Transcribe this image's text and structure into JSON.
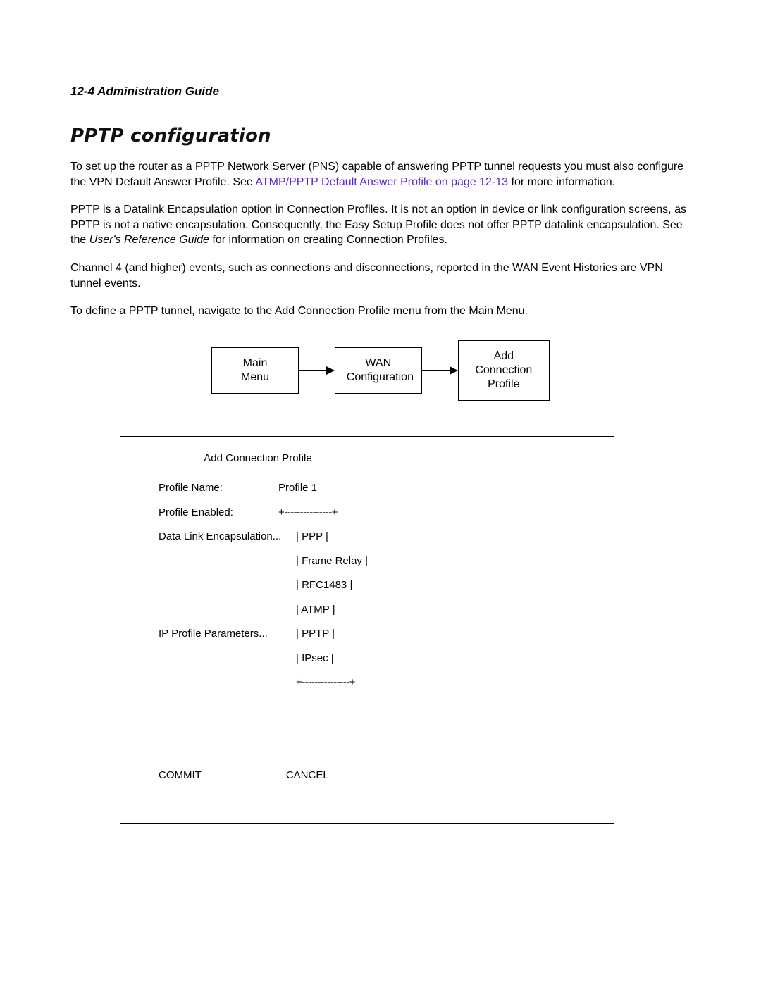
{
  "header": {
    "page_ref": "12-4",
    "doc_title": "Administration Guide"
  },
  "section_title": "PPTP configuration",
  "paragraphs": {
    "p1_a": "To set up the router as a PPTP Network Server (PNS) capable of answering PPTP tunnel requests you must also configure the VPN Default Answer Profile. See ",
    "p1_link": "ATMP/PPTP Default Answer Profile on page 12-13",
    "p1_b": " for more information.",
    "p2_a": "PPTP is a Datalink Encapsulation option in Connection Profiles. It is not an option in device or link configuration screens, as PPTP is not a native encapsulation. Consequently, the Easy Setup Profile does not offer PPTP datalink encapsulation. See the ",
    "p2_italic": "User's Reference Guide",
    "p2_b": " for information on creating Connection Profiles.",
    "p3": "Channel 4 (and higher) events, such as connections and disconnections, reported in the WAN Event Histories are VPN tunnel events.",
    "p4": "To define a PPTP tunnel, navigate to the Add Connection Profile menu from the Main Menu."
  },
  "flow": {
    "box1": "Main\nMenu",
    "box2": "WAN\nConfiguration",
    "box3": "Add Connection\nProfile"
  },
  "terminal": {
    "title": "Add Connection Profile",
    "labels": {
      "profile_name": "Profile Name:",
      "profile_enabled": "Profile Enabled:",
      "data_link": "Data Link Encapsulation...",
      "ip_params": "IP Profile Parameters..."
    },
    "values": {
      "profile_name": "Profile 1"
    },
    "options": {
      "opt1": "PPP",
      "opt2": "Frame Relay",
      "opt3": "RFC1483",
      "opt4": "ATMP",
      "opt5": "PPTP",
      "opt6": "IPsec"
    },
    "border_top": "+---------------+",
    "border_bot": "+---------------+",
    "actions": {
      "commit": "COMMIT",
      "cancel": "CANCEL"
    }
  }
}
